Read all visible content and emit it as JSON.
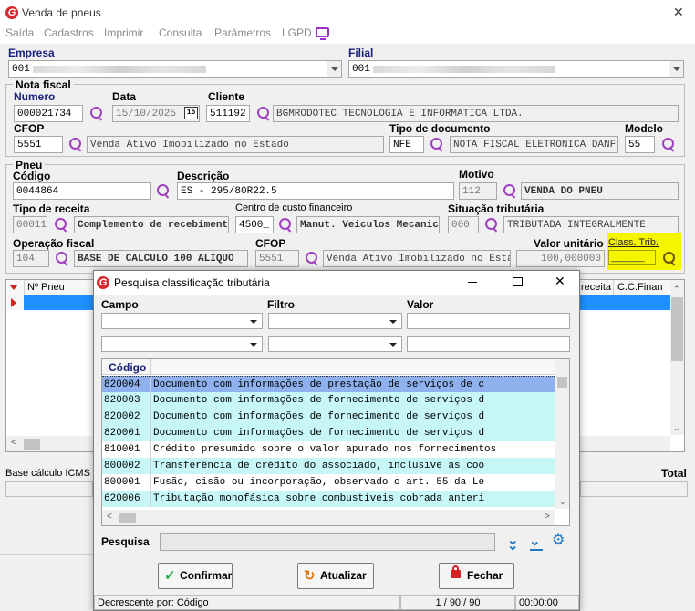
{
  "window": {
    "title": "Venda de pneus"
  },
  "menu": {
    "items": [
      "Saída",
      "Cadastros",
      "Imprimir",
      "Consulta",
      "Parâmetros",
      "LGPD"
    ]
  },
  "empresa": {
    "label": "Empresa",
    "code": "001"
  },
  "filial": {
    "label": "Filial",
    "code": "001"
  },
  "nota_fiscal": {
    "legend": "Nota fiscal",
    "numero_label": "Numero",
    "numero": "000021734",
    "data_label": "Data",
    "data": "15/10/2025",
    "calendar_day": "15",
    "cliente_label": "Cliente",
    "cliente_code": "511192",
    "cliente_name": "BGMRODOTEC TECNOLOGIA E INFORMATICA LTDA.",
    "cfop_label": "CFOP",
    "cfop_code": "5551",
    "cfop_desc": "Venda Ativo Imobilizado no Estado",
    "tipo_doc_label": "Tipo de documento",
    "tipo_doc_code": "NFE",
    "tipo_doc_desc": "NOTA FISCAL ELETRONICA DANFE",
    "modelo_label": "Modelo",
    "modelo": "55"
  },
  "pneu": {
    "legend": "Pneu",
    "codigo_label": "Código",
    "codigo": "0044864",
    "descricao_label": "Descrição",
    "descricao": "ES - 295/80R22.5",
    "motivo_label": "Motivo",
    "motivo_code": "112",
    "motivo_desc": "VENDA DO PNEU",
    "tipo_receita_label": "Tipo de receita",
    "tipo_receita_code": "00011",
    "tipo_receita_desc": "Complemento de recebimento",
    "centro_custo_label": "Centro de custo financeiro",
    "centro_custo_code": "4500_",
    "centro_custo_desc": "Manut. Veiculos Mecanica",
    "situacao_label": "Situação tributária",
    "situacao_code": "000",
    "situacao_desc": "TRIBUTADA INTEGRALMENTE",
    "operacao_label": "Operação fiscal",
    "operacao_code": "104",
    "operacao_desc": "BASE DE CALCULO 100 ALIQUO",
    "cfop_label": "CFOP",
    "cfop_code": "5551",
    "cfop_desc": "Venda Ativo Imobilizado no Estado",
    "valor_label": "Valor unitário",
    "valor": "100,000000",
    "class_trib_label": "Class. Trib.",
    "class_trib_value": "______"
  },
  "grid": {
    "columns": [
      "Nº Pneu",
      "receita",
      "C.C.Finan"
    ]
  },
  "footer": {
    "base_calc_label": "Base cálculo ICMS",
    "total_label": "Total"
  },
  "dialog": {
    "title": "Pesquisa classificação tributária",
    "campo_label": "Campo",
    "filtro_label": "Filtro",
    "valor_label": "Valor",
    "col_codigo": "Código",
    "rows": [
      {
        "code": "820004",
        "desc": "Documento com informações de prestação de serviços de c",
        "state": "selected"
      },
      {
        "code": "820003",
        "desc": "Documento com informações de fornecimento de serviços d",
        "state": "highlight"
      },
      {
        "code": "820002",
        "desc": "Documento com informações de fornecimento de serviços d",
        "state": "highlight"
      },
      {
        "code": "820001",
        "desc": "Documento com informações de fornecimento de serviços d",
        "state": "highlight"
      },
      {
        "code": "810001",
        "desc": "Crédito presumido sobre o valor apurado nos fornecimentos",
        "state": "normal"
      },
      {
        "code": "800002",
        "desc": "Transferência de crédito do associado, inclusive as coo",
        "state": "highlight"
      },
      {
        "code": "800001",
        "desc": "Fusão, cisão ou incorporação, observado o art. 55 da Le",
        "state": "normal"
      },
      {
        "code": "620006",
        "desc": "Tributação monofásica sobre combustíveis cobrada anteri",
        "state": "highlight"
      }
    ],
    "pesquisa_label": "Pesquisa",
    "confirm_label": "Confirmar",
    "update_label": "Atualizar",
    "close_label": "Fechar",
    "status_sort": "Decrescente por: Código",
    "status_count": "1 / 90 / 90",
    "status_time": "00:00:00"
  },
  "colors": {
    "selected_row": "#8fb2ee",
    "highlight_row": "#c6f6f6",
    "class_trib_bg": "#f5f500",
    "accent_purple": "#a040c0"
  }
}
